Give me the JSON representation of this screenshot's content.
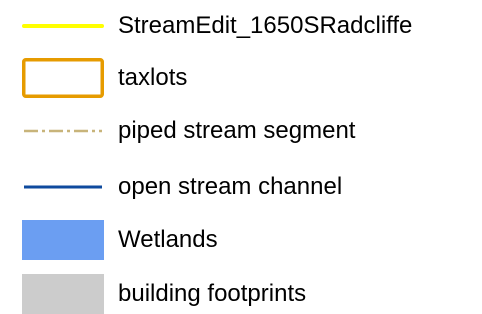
{
  "legend": {
    "items": [
      {
        "label": "StreamEdit_1650SRadcliffe",
        "symbol": "line",
        "color": "#ffff00"
      },
      {
        "label": "taxlots",
        "symbol": "hollow-box",
        "color": "#e69b00"
      },
      {
        "label": "piped stream segment",
        "symbol": "dash-dot-line",
        "color": "#c8b47a"
      },
      {
        "label": "open stream channel",
        "symbol": "line",
        "color": "#0e4a9e"
      },
      {
        "label": "Wetlands",
        "symbol": "fill-box",
        "color": "#6b9ef2"
      },
      {
        "label": "building footprints",
        "symbol": "fill-box",
        "color": "#cccccc"
      }
    ]
  }
}
